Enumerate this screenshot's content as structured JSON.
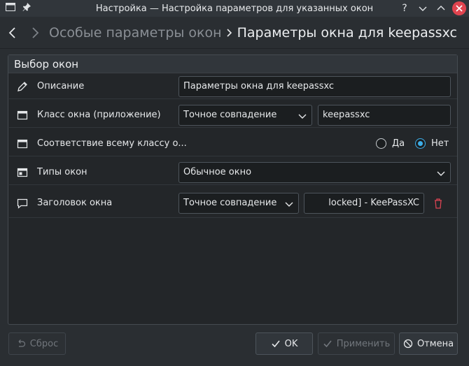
{
  "window": {
    "title": "Настройка — Настройка параметров для указанных окон"
  },
  "breadcrumb": {
    "previous": "Особые параметры окон",
    "current": "Параметры окна для keepassxc"
  },
  "group": {
    "title": "Выбор окон"
  },
  "rows": {
    "description": {
      "label": "Описание",
      "value": "Параметры окна для keepassxc"
    },
    "window_class": {
      "label": "Класс окна (приложение)",
      "match_type": "Точное совпадение",
      "value": "keepassxc"
    },
    "whole_class": {
      "label": "Соответствие всему классу о...",
      "option_yes": "Да",
      "option_no": "Нет",
      "selected": "Нет"
    },
    "window_types": {
      "label": "Типы окон",
      "value": "Обычное окно"
    },
    "window_title": {
      "label": "Заголовок окна",
      "match_type": "Точное совпадение",
      "value": "locked] - KeePassXC",
      "value_visible": "locked] - KeePassXC"
    }
  },
  "buttons": {
    "reset": "Сброс",
    "ok": "OK",
    "apply": "Применить",
    "cancel": "Отмена"
  },
  "colors": {
    "accent": "#3daee9",
    "delete": "#da4453",
    "close": "#e0444f"
  },
  "icons": {
    "pin": "pin-icon",
    "description": "pencil-icon",
    "window": "window-icon",
    "window_types": "window-types-icon",
    "title": "speech-bubble-icon",
    "delete": "trash-icon"
  }
}
